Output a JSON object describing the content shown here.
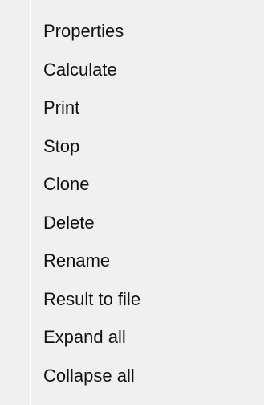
{
  "context_menu": {
    "items": [
      {
        "label": "Properties"
      },
      {
        "label": "Calculate"
      },
      {
        "label": "Print"
      },
      {
        "label": "Stop"
      },
      {
        "label": "Clone"
      },
      {
        "label": "Delete"
      },
      {
        "label": "Rename"
      },
      {
        "label": "Result to file"
      },
      {
        "label": "Expand all"
      },
      {
        "label": "Collapse all"
      }
    ]
  },
  "colors": {
    "background": "#f0f0f0",
    "text": "#111111",
    "gutter_line": "#e3e3e3"
  }
}
